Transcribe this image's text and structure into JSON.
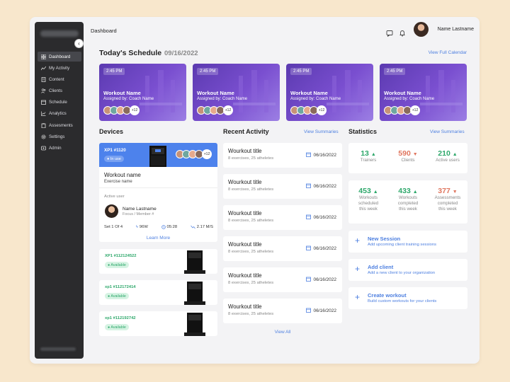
{
  "header": {
    "page_title": "Dashboard",
    "user_name": "Name Lastname"
  },
  "sidebar": {
    "items": [
      {
        "label": "Dashboard",
        "icon": "grid-icon",
        "active": true
      },
      {
        "label": "My Activity",
        "icon": "activity-chart-icon"
      },
      {
        "label": "Content",
        "icon": "file-icon"
      },
      {
        "label": "Clients",
        "icon": "users-icon"
      },
      {
        "label": "Schedule",
        "icon": "calendar-icon"
      },
      {
        "label": "Analytics",
        "icon": "line-chart-icon"
      },
      {
        "label": "Assesments",
        "icon": "clipboard-icon"
      },
      {
        "label": "Settings",
        "icon": "gear-icon"
      },
      {
        "label": "Admin",
        "icon": "admin-icon"
      }
    ]
  },
  "schedule": {
    "title": "Today's Schedule",
    "date": "09/16/2022",
    "view_link": "View Full Calendar",
    "cards": [
      {
        "time": "2:45 PM",
        "name": "Workout Name",
        "coach": "Assigned by: Coach Name",
        "more": "+12"
      },
      {
        "time": "2:45 PM",
        "name": "Workout Name",
        "coach": "Assigned by: Coach Name",
        "more": "+12"
      },
      {
        "time": "2:45 PM",
        "name": "Workout Name",
        "coach": "Assigned by: Coach Name",
        "more": "+12"
      },
      {
        "time": "2:45 PM",
        "name": "Workout Name",
        "coach": "Assigned by: Coach Name",
        "more": "+12"
      }
    ]
  },
  "devices": {
    "title": "Devices",
    "main": {
      "id": "XP1 #1120",
      "status": "In use",
      "more": "+12",
      "workout_name": "Workout name",
      "exercise_name": "Exercise name",
      "active_user_label": "Active user",
      "member_name": "Name Lastname",
      "member_sub": "Focus / Member #",
      "set": "Set 1 Of 4",
      "power": "96W",
      "time": "05:28",
      "speed": "2.17 M/S",
      "learn_more": "Learn More"
    },
    "others": [
      {
        "id": "XP1 #112124522",
        "status": "Available"
      },
      {
        "id": "xp1 #112172414",
        "status": "Available"
      },
      {
        "id": "xp1 #112192742",
        "status": "Available"
      }
    ]
  },
  "activity": {
    "title": "Recent Activity",
    "view_link": "View Summaries",
    "items": [
      {
        "title": "Wourkout title",
        "sub": "8 exercises, 25 atheletes",
        "date": "06/16/2022"
      },
      {
        "title": "Wourkout title",
        "sub": "8 exercises, 25 atheletes",
        "date": "06/16/2022"
      },
      {
        "title": "Wourkout title",
        "sub": "8 exercises, 25 atheletes",
        "date": "06/16/2022"
      },
      {
        "title": "Wourkout title",
        "sub": "8 exercises, 25 atheletes",
        "date": "06/16/2022"
      },
      {
        "title": "Wourkout title",
        "sub": "8 exercises, 25 atheletes",
        "date": "06/16/2022"
      },
      {
        "title": "Wourkout title",
        "sub": "8 exercises, 25 atheletes",
        "date": "06/16/2022"
      }
    ],
    "view_all": "View All"
  },
  "statistics": {
    "title": "Statistics",
    "view_link": "View Summaries",
    "row1": [
      {
        "value": "13",
        "label": "Trainers",
        "trend": "up"
      },
      {
        "value": "590",
        "label": "Clients",
        "trend": "down"
      },
      {
        "value": "210",
        "label": "Active users",
        "trend": "up"
      }
    ],
    "row2": [
      {
        "value": "453",
        "label_l1": "Workouts",
        "label_l2": "scheduled",
        "label_l3": "this week",
        "trend": "up"
      },
      {
        "value": "433",
        "label_l1": "Workouts",
        "label_l2": "completed",
        "label_l3": "this week",
        "trend": "up"
      },
      {
        "value": "377",
        "label_l1": "Assessments",
        "label_l2": "completed",
        "label_l3": "this week",
        "trend": "down"
      }
    ]
  },
  "actions": [
    {
      "title": "New Session",
      "sub": "Add upcoming client training sessions"
    },
    {
      "title": "Add client",
      "sub": "Add a new client to your organization"
    },
    {
      "title": "Create workout",
      "sub": "Build custom workouts for your clients"
    }
  ],
  "colors": {
    "accent": "#4d7fe0",
    "positive": "#2ea86b",
    "negative": "#e0765f",
    "sidebar": "#2b2b2d",
    "card_purple": "#6a45c4"
  }
}
